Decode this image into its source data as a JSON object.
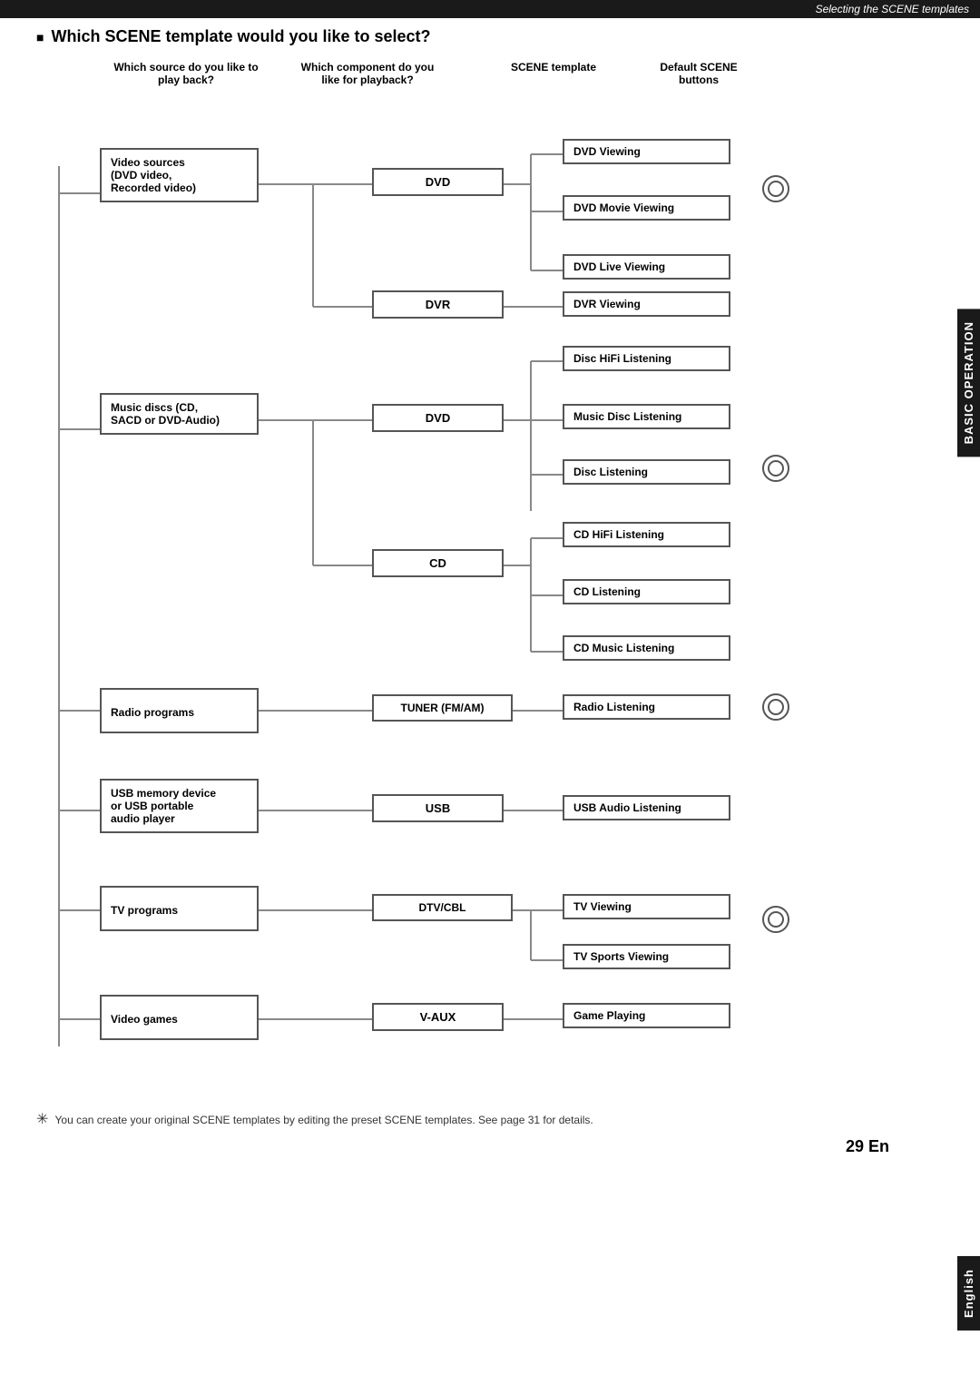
{
  "header": {
    "top_bar": "Selecting the SCENE templates"
  },
  "title": "Which SCENE template would you like to select?",
  "columns": {
    "source": "Which source do you like to\nplay back?",
    "component": "Which component do you\nlike for playback?",
    "scene": "SCENE template",
    "default": "Default SCENE\nbuttons"
  },
  "sources": [
    {
      "id": "video-sources",
      "label": "Video sources\n(DVD video,\nRecorded video)"
    },
    {
      "id": "music-discs",
      "label": "Music discs (CD,\nSACD or DVD-Audio)"
    },
    {
      "id": "radio-programs",
      "label": "Radio programs"
    },
    {
      "id": "usb-device",
      "label": "USB memory device\nor USB portable\naudio player"
    },
    {
      "id": "tv-programs",
      "label": "TV programs"
    },
    {
      "id": "video-games",
      "label": "Video games"
    }
  ],
  "components": [
    {
      "id": "dvd1",
      "label": "DVD"
    },
    {
      "id": "dvr",
      "label": "DVR"
    },
    {
      "id": "dvd2",
      "label": "DVD"
    },
    {
      "id": "cd",
      "label": "CD"
    },
    {
      "id": "tuner",
      "label": "TUNER (FM/AM)"
    },
    {
      "id": "usb",
      "label": "USB"
    },
    {
      "id": "dtvcbl",
      "label": "DTV/CBL"
    },
    {
      "id": "vaux",
      "label": "V-AUX"
    }
  ],
  "scenes": [
    {
      "id": "dvd-viewing",
      "label": "DVD Viewing"
    },
    {
      "id": "dvd-movie-viewing",
      "label": "DVD Movie Viewing"
    },
    {
      "id": "dvd-live-viewing",
      "label": "DVD Live Viewing"
    },
    {
      "id": "dvr-viewing",
      "label": "DVR Viewing"
    },
    {
      "id": "disc-hifi-listening",
      "label": "Disc HiFi Listening"
    },
    {
      "id": "music-disc-listening",
      "label": "Music Disc Listening"
    },
    {
      "id": "disc-listening",
      "label": "Disc Listening"
    },
    {
      "id": "cd-hifi-listening",
      "label": "CD HiFi Listening"
    },
    {
      "id": "cd-listening",
      "label": "CD Listening"
    },
    {
      "id": "cd-music-listening",
      "label": "CD Music Listening"
    },
    {
      "id": "radio-listening",
      "label": "Radio Listening"
    },
    {
      "id": "usb-audio-listening",
      "label": "USB Audio Listening"
    },
    {
      "id": "tv-viewing",
      "label": "TV Viewing"
    },
    {
      "id": "tv-sports-viewing",
      "label": "TV Sports Viewing"
    },
    {
      "id": "game-playing",
      "label": "Game Playing"
    }
  ],
  "side_tab": "BASIC\nOPERATION",
  "side_tab_bottom": "English",
  "footer_note": "You can create your original SCENE templates by editing the preset SCENE templates. See page 31 for details.",
  "page_number": "29 En"
}
